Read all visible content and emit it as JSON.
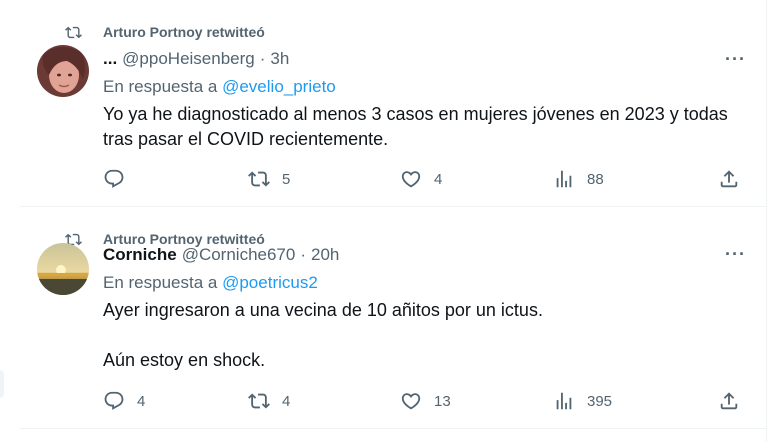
{
  "tweets": [
    {
      "retweeted_by": "Arturo Portnoy retwitteó",
      "display_name": "...",
      "handle": "@ppoHeisenberg",
      "separator": "·",
      "time": "3h",
      "reply_prefix": "En respuesta a",
      "reply_mention": "@evelio_prieto",
      "text": "Yo ya he diagnosticado al menos 3 casos en mujeres jóvenes en 2023 y todas tras pasar el COVID recientemente.",
      "more": "···",
      "replies": "",
      "retweets": "5",
      "likes": "4",
      "views": "88",
      "avatar_icon": "profile-photo"
    },
    {
      "retweeted_by": "Arturo Portnoy retwitteó",
      "display_name": "Corniche",
      "handle": "@Corniche670",
      "separator": "·",
      "time": "20h",
      "reply_prefix": "En respuesta a",
      "reply_mention": "@poetricus2",
      "text": "Ayer ingresaron a una vecina de 10 añitos por un ictus.\n\nAún estoy en shock.",
      "more": "···",
      "replies": "4",
      "retweets": "4",
      "likes": "13",
      "views": "395",
      "avatar_icon": "sunset-photo"
    }
  ],
  "colors": {
    "text": "#0f1419",
    "secondary": "#536471",
    "link": "#1d9bf0",
    "border": "#eff3f4"
  },
  "icons": [
    "retweet-icon",
    "reply-icon",
    "like-icon",
    "views-icon",
    "share-icon",
    "more-icon"
  ]
}
